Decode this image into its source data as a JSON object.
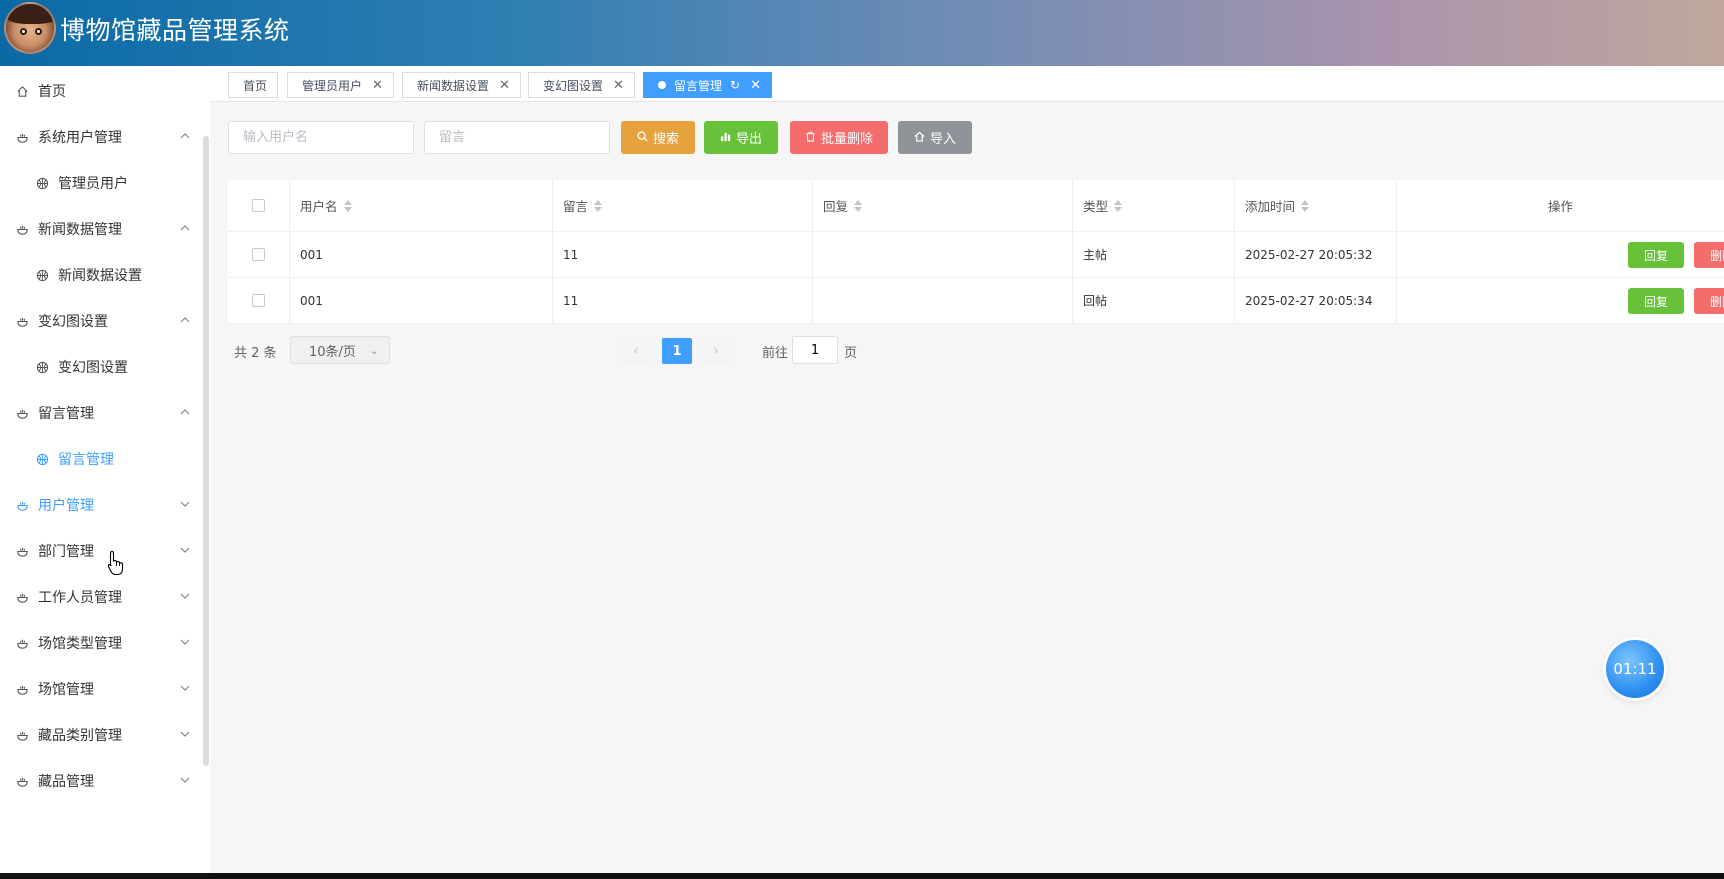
{
  "app": {
    "title": "博物馆藏品管理系统"
  },
  "sidebar": {
    "items": [
      {
        "label": "首页",
        "type": "home"
      },
      {
        "label": "系统用户管理",
        "type": "group",
        "expanded": true
      },
      {
        "label": "管理员用户",
        "type": "sub"
      },
      {
        "label": "新闻数据管理",
        "type": "group",
        "expanded": true
      },
      {
        "label": "新闻数据设置",
        "type": "sub"
      },
      {
        "label": "变幻图设置",
        "type": "group",
        "expanded": true
      },
      {
        "label": "变幻图设置",
        "type": "sub"
      },
      {
        "label": "留言管理",
        "type": "group",
        "expanded": true
      },
      {
        "label": "留言管理",
        "type": "sub",
        "active": true
      },
      {
        "label": "用户管理",
        "type": "group",
        "expanded": false,
        "hover": true
      },
      {
        "label": "部门管理",
        "type": "group",
        "expanded": false
      },
      {
        "label": "工作人员管理",
        "type": "group",
        "expanded": false
      },
      {
        "label": "场馆类型管理",
        "type": "group",
        "expanded": false
      },
      {
        "label": "场馆管理",
        "type": "group",
        "expanded": false
      },
      {
        "label": "藏品类别管理",
        "type": "group",
        "expanded": false
      },
      {
        "label": "藏品管理",
        "type": "group",
        "expanded": false
      }
    ]
  },
  "tabs": [
    {
      "label": "首页",
      "closable": false
    },
    {
      "label": "管理员用户",
      "closable": true
    },
    {
      "label": "新闻数据设置",
      "closable": true
    },
    {
      "label": "变幻图设置",
      "closable": true
    },
    {
      "label": "留言管理",
      "closable": true,
      "active": true
    }
  ],
  "toolbar": {
    "username_placeholder": "输入用户名",
    "message_placeholder": "留言",
    "search": "搜索",
    "export": "导出",
    "batch_delete": "批量删除",
    "import": "导入"
  },
  "table": {
    "columns": [
      "用户名",
      "留言",
      "回复",
      "类型",
      "添加时间",
      "操作"
    ],
    "rows": [
      {
        "username": "001",
        "message": "11",
        "reply": "",
        "type": "主帖",
        "time": "2025-02-27 20:05:32"
      },
      {
        "username": "001",
        "message": "11",
        "reply": "",
        "type": "回帖",
        "time": "2025-02-27 20:05:34"
      }
    ],
    "reply_btn": "回复",
    "delete_btn": "删除"
  },
  "pagination": {
    "total": "共 2 条",
    "page_size": "10条/页",
    "current": "1",
    "goto_label": "前往",
    "goto_value": "1",
    "goto_suffix": "页"
  },
  "timer": {
    "text": "01:11"
  },
  "colors": {
    "primary": "#409eff",
    "warning": "#e6a23c",
    "success": "#67c23a",
    "danger": "#f56c6c",
    "info": "#909399"
  }
}
